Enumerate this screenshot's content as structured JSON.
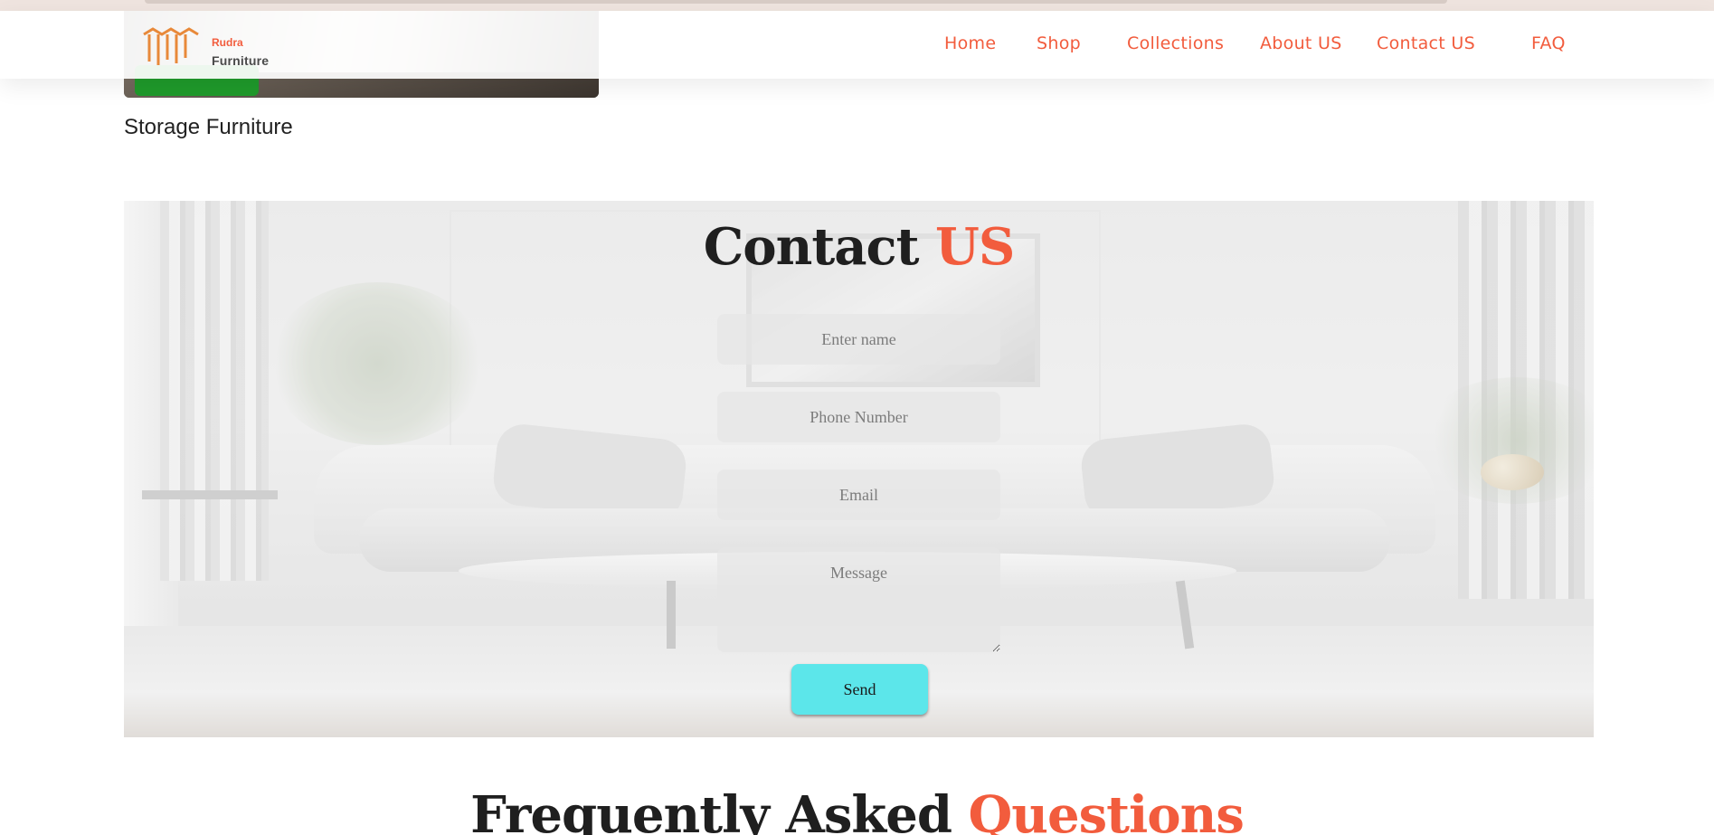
{
  "brand": {
    "name_top": "Rudra",
    "name_bottom": "Furniture",
    "logo_icon": "furniture-logo-icon",
    "accent_color": "#f25c3d"
  },
  "nav": {
    "items": [
      {
        "label": "Home"
      },
      {
        "label": "Shop"
      },
      {
        "label": "Collections"
      },
      {
        "label": "About US"
      },
      {
        "label": "Contact US"
      },
      {
        "label": "FAQ"
      }
    ]
  },
  "product": {
    "title": "Storage Furniture",
    "button_color": "#1f9a2b"
  },
  "contact": {
    "title_main": "Contact",
    "title_accent": "US",
    "fields": {
      "name_placeholder": "Enter name",
      "phone_placeholder": "Phone Number",
      "email_placeholder": "Email",
      "message_placeholder": "Message"
    },
    "send_label": "Send",
    "send_color": "#5ce6ea"
  },
  "faq": {
    "title_main": "Frequently Asked",
    "title_accent": "Questions"
  }
}
